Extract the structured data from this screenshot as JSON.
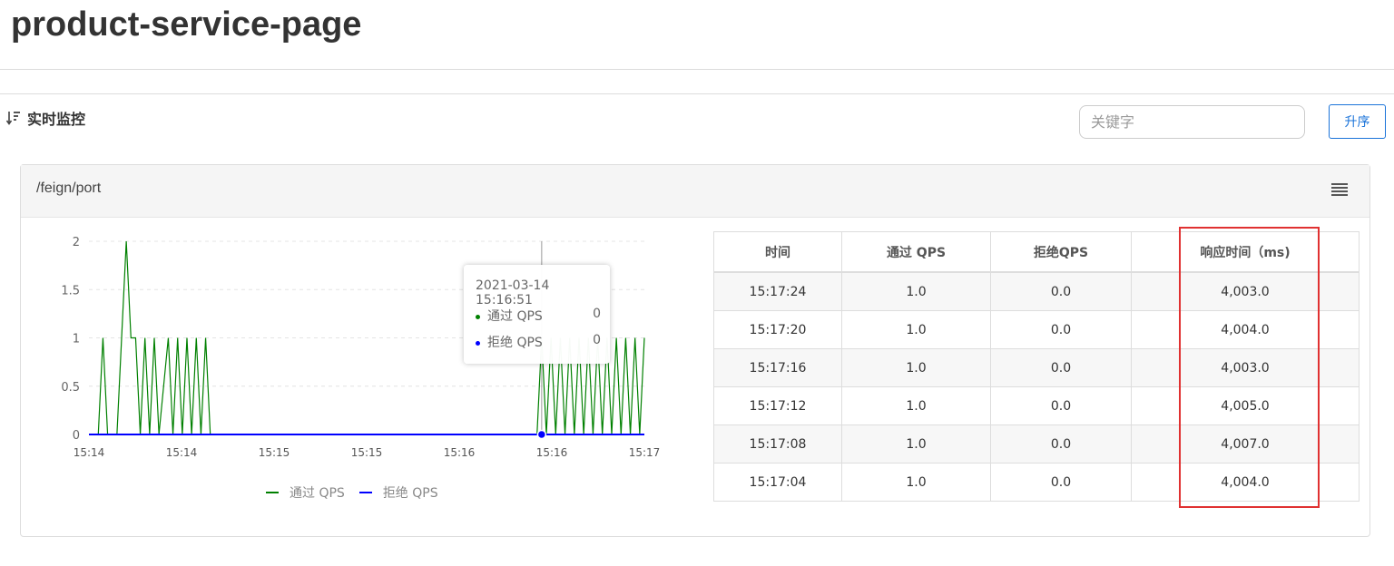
{
  "page": {
    "title": "product-service-page"
  },
  "monitor": {
    "title": "实时监控",
    "sort_icon": "sort-desc-icon",
    "search_placeholder": "关键字",
    "sort_button_label": "升序"
  },
  "panel": {
    "resource_name": "/feign/port",
    "menu_icon": "hamburger-menu-icon"
  },
  "colors": {
    "pass_qps": "#008000",
    "block_qps": "#0000ff",
    "accent": "#1a73d9",
    "highlight": "#e03131"
  },
  "tooltip": {
    "title": "2021-03-14 15:16:51",
    "rows": [
      {
        "label": "通过 QPS",
        "value": "0"
      },
      {
        "label": "拒绝 QPS",
        "value": "0"
      }
    ]
  },
  "chart_data": {
    "type": "line",
    "title": "",
    "xlabel": "",
    "ylabel": "",
    "ylim": [
      0,
      2
    ],
    "y_ticks": [
      "0",
      "0.5",
      "1",
      "1.5",
      "2"
    ],
    "x_tick_labels": [
      "15:14",
      "15:14",
      "15:15",
      "15:15",
      "15:16",
      "15:16",
      "15:17"
    ],
    "grid": true,
    "legend_position": "bottom-center",
    "x_count": 120,
    "hover_index": 97,
    "series": [
      {
        "name": "通过 QPS",
        "color": "#008000",
        "points": [
          [
            0,
            0
          ],
          [
            2,
            0
          ],
          [
            3,
            1
          ],
          [
            4,
            0
          ],
          [
            6,
            0
          ],
          [
            8,
            2
          ],
          [
            9,
            1
          ],
          [
            10,
            1
          ],
          [
            11,
            0
          ],
          [
            12,
            1
          ],
          [
            13,
            0
          ],
          [
            14,
            1
          ],
          [
            15,
            0
          ],
          [
            17,
            1
          ],
          [
            18,
            0
          ],
          [
            19,
            1
          ],
          [
            20,
            0
          ],
          [
            21,
            1
          ],
          [
            22,
            0
          ],
          [
            23,
            1
          ],
          [
            24,
            0
          ],
          [
            25,
            1
          ],
          [
            26,
            0
          ],
          [
            96,
            0
          ],
          [
            97,
            1
          ],
          [
            98,
            0
          ],
          [
            99,
            1
          ],
          [
            100,
            0
          ],
          [
            101,
            1
          ],
          [
            102,
            0
          ],
          [
            103,
            1
          ],
          [
            104,
            0
          ],
          [
            105,
            1
          ],
          [
            106,
            0
          ],
          [
            107,
            1
          ],
          [
            108,
            0
          ],
          [
            109,
            1
          ],
          [
            110,
            0
          ],
          [
            111,
            1
          ],
          [
            112,
            0
          ],
          [
            113,
            1
          ],
          [
            114,
            0
          ],
          [
            115,
            1
          ],
          [
            116,
            0
          ],
          [
            117,
            1
          ],
          [
            118,
            0
          ],
          [
            119,
            1
          ]
        ]
      },
      {
        "name": "拒绝 QPS",
        "color": "#0000ff",
        "points": [
          [
            0,
            0
          ],
          [
            119,
            0
          ]
        ]
      }
    ]
  },
  "table": {
    "headers": [
      "时间",
      "通过 QPS",
      "拒绝QPS",
      "响应时间（ms)"
    ],
    "rows": [
      [
        "15:17:24",
        "1.0",
        "0.0",
        "4,003.0"
      ],
      [
        "15:17:20",
        "1.0",
        "0.0",
        "4,004.0"
      ],
      [
        "15:17:16",
        "1.0",
        "0.0",
        "4,003.0"
      ],
      [
        "15:17:12",
        "1.0",
        "0.0",
        "4,005.0"
      ],
      [
        "15:17:08",
        "1.0",
        "0.0",
        "4,007.0"
      ],
      [
        "15:17:04",
        "1.0",
        "0.0",
        "4,004.0"
      ]
    ]
  }
}
